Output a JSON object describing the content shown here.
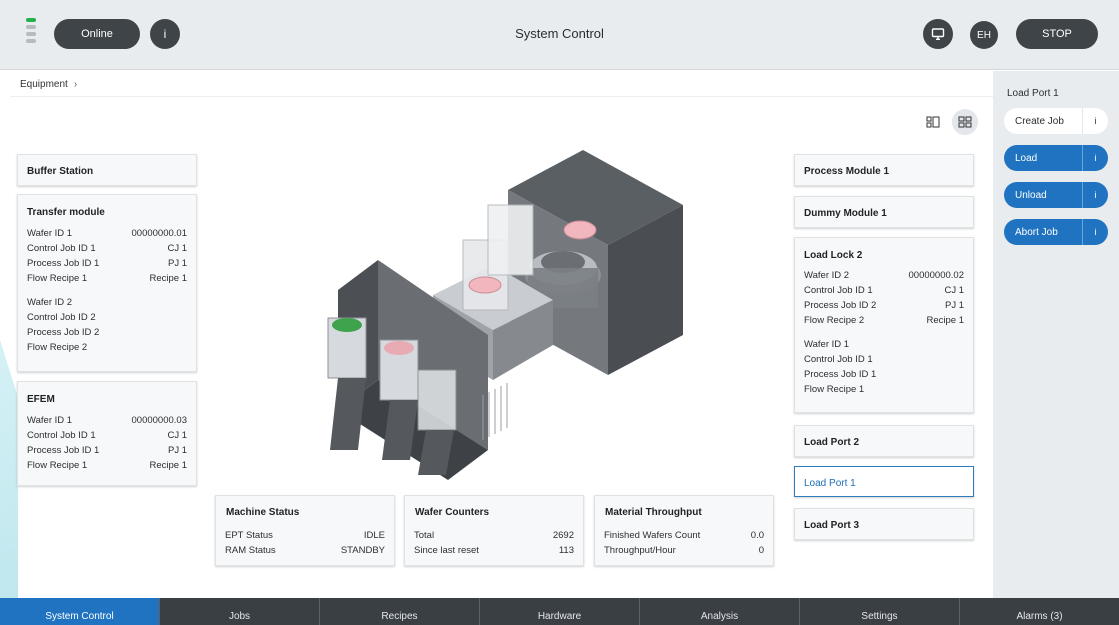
{
  "topbar": {
    "title": "System Control",
    "online_label": "Online",
    "info_label": "i",
    "user_initials": "EH",
    "stop_label": "STOP"
  },
  "breadcrumb": {
    "item": "Equipment",
    "separator": "›"
  },
  "left_cards": {
    "buffer_station": {
      "title": "Buffer Station"
    },
    "transfer_module": {
      "title": "Transfer module",
      "group1": [
        {
          "label": "Wafer ID 1",
          "value": "00000000.01"
        },
        {
          "label": "Control Job ID 1",
          "value": "CJ 1"
        },
        {
          "label": "Process Job ID 1",
          "value": "PJ 1"
        },
        {
          "label": "Flow Recipe 1",
          "value": "Recipe 1"
        }
      ],
      "group2": [
        {
          "label": "Wafer ID 2",
          "value": ""
        },
        {
          "label": "Control Job ID 2",
          "value": ""
        },
        {
          "label": "Process Job ID 2",
          "value": ""
        },
        {
          "label": "Flow Recipe 2",
          "value": ""
        }
      ]
    },
    "efem": {
      "title": "EFEM",
      "rows": [
        {
          "label": "Wafer ID 1",
          "value": "00000000.03"
        },
        {
          "label": "Control Job ID 1",
          "value": "CJ 1"
        },
        {
          "label": "Process Job ID 1",
          "value": "PJ 1"
        },
        {
          "label": "Flow Recipe 1",
          "value": "Recipe 1"
        }
      ]
    }
  },
  "right_cards": {
    "process_module_1": {
      "title": "Process Module 1"
    },
    "dummy_module_1": {
      "title": "Dummy Module 1"
    },
    "load_lock_2": {
      "title": "Load Lock 2",
      "group1": [
        {
          "label": "Wafer ID 2",
          "value": "00000000.02"
        },
        {
          "label": "Control Job ID 1",
          "value": "CJ 1"
        },
        {
          "label": "Process Job ID 2",
          "value": "PJ 1"
        },
        {
          "label": "Flow Recipe 2",
          "value": "Recipe 1"
        }
      ],
      "group2": [
        {
          "label": "Wafer ID 1",
          "value": ""
        },
        {
          "label": "Control Job ID 1",
          "value": ""
        },
        {
          "label": "Process Job ID 1",
          "value": ""
        },
        {
          "label": "Flow Recipe 1",
          "value": ""
        }
      ]
    },
    "load_port_2": {
      "title": "Load Port 2"
    },
    "load_port_1": {
      "title": "Load Port 1"
    },
    "load_port_3": {
      "title": "Load Port 3"
    }
  },
  "status": {
    "machine": {
      "title": "Machine Status",
      "rows": [
        {
          "label": "EPT Status",
          "value": "IDLE"
        },
        {
          "label": "RAM Status",
          "value": "STANDBY"
        }
      ]
    },
    "wafer_counters": {
      "title": "Wafer Counters",
      "rows": [
        {
          "label": "Total",
          "value": "2692"
        },
        {
          "label": "Since last reset",
          "value": "113"
        }
      ]
    },
    "throughput": {
      "title": "Material Throughput",
      "rows": [
        {
          "label": "Finished Wafers Count",
          "value": "0.0"
        },
        {
          "label": "Throughput/Hour",
          "value": "0"
        }
      ]
    }
  },
  "right_panel": {
    "title": "Load Port 1",
    "buttons": [
      {
        "label": "Create Job",
        "info": "i"
      },
      {
        "label": "Load",
        "info": "i"
      },
      {
        "label": "Unload",
        "info": "i"
      },
      {
        "label": "Abort Job",
        "info": "i"
      }
    ]
  },
  "bottom_nav": {
    "tabs": [
      "System Control",
      "Jobs",
      "Recipes",
      "Hardware",
      "Analysis",
      "Settings",
      "Alarms (3)"
    ],
    "active": "System Control"
  },
  "colors": {
    "accent": "#1f73c0",
    "topbar": "#e9ecef",
    "dark_pill": "#3f4449",
    "status_led": "#22b14c",
    "nav": "#3a3f44",
    "highlight_green": "#1fc04a"
  },
  "icons": {
    "status_led": "status-led-icon",
    "info": "info-icon",
    "screen": "monitor-icon",
    "view_single": "single-view-icon",
    "view_grid": "grid-view-icon"
  }
}
